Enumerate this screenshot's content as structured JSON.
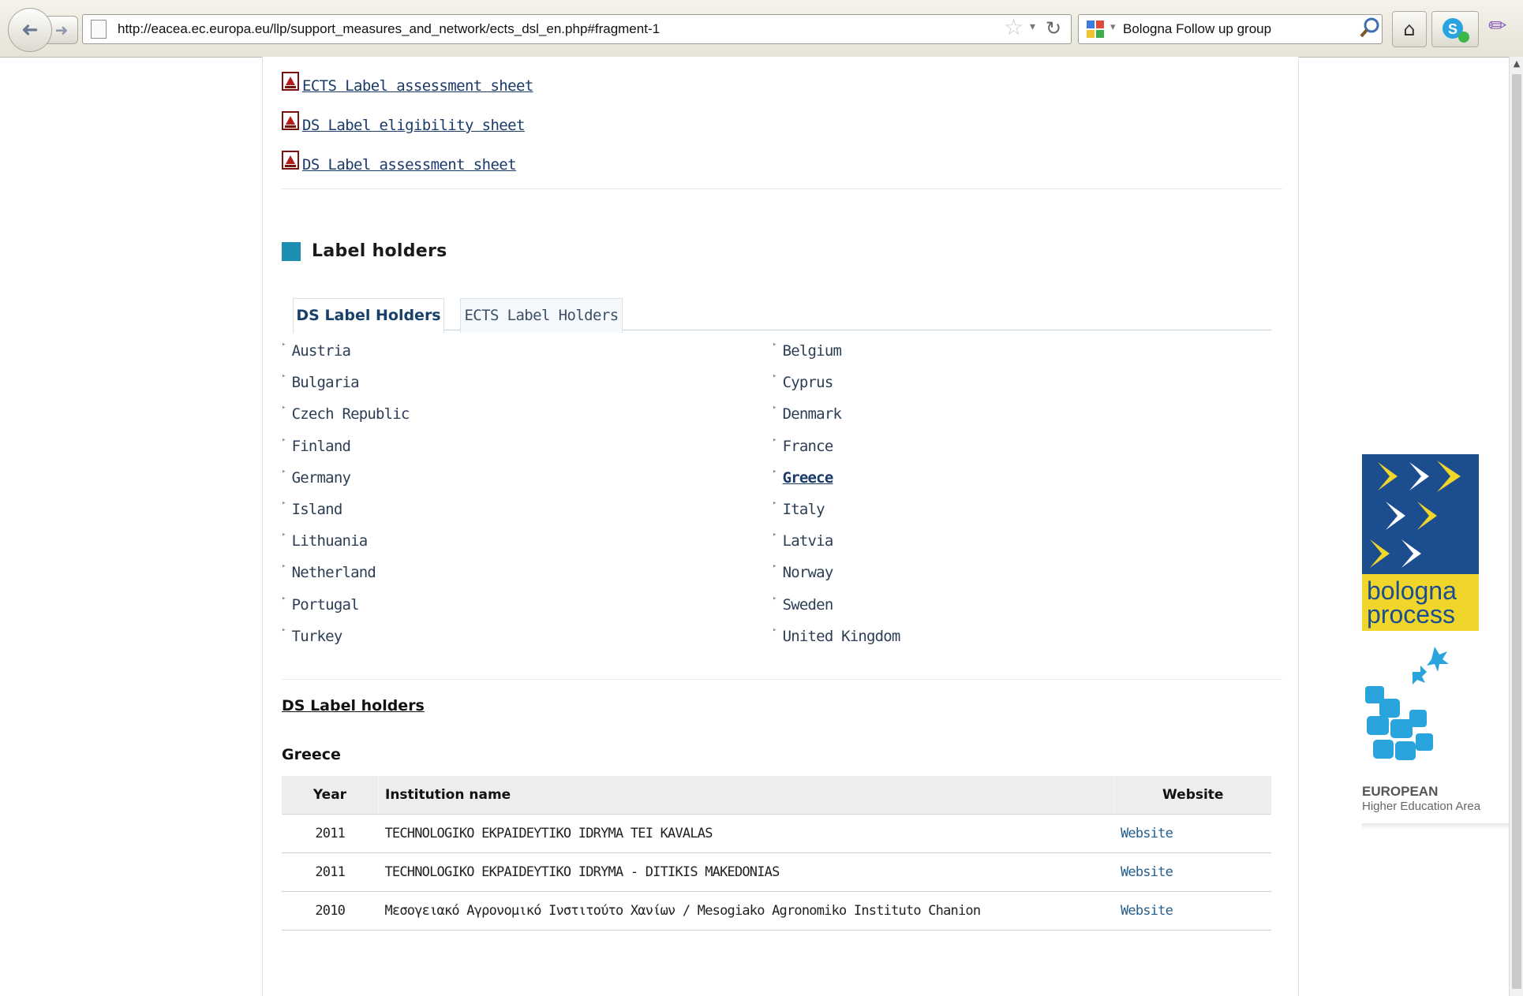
{
  "browser": {
    "url": "http://eacea.ec.europa.eu/llp/support_measures_and_network/ects_dsl_en.php#fragment-1",
    "search_text": "Bologna Follow up group"
  },
  "documents": [
    {
      "label": "ECTS Label assessment sheet"
    },
    {
      "label": "DS Label eligibility sheet"
    },
    {
      "label": "DS Label assessment sheet"
    }
  ],
  "section": {
    "title": "Label holders"
  },
  "tabs": [
    {
      "label": "DS Label Holders",
      "active": true
    },
    {
      "label": "ECTS Label Holders",
      "active": false
    }
  ],
  "countries": {
    "left": [
      "Austria",
      "Bulgaria",
      "Czech Republic",
      "Finland",
      "Germany",
      "Island",
      "Lithuania",
      "Netherland",
      "Portugal",
      "Turkey"
    ],
    "right": [
      "Belgium",
      "Cyprus",
      "Denmark",
      "France",
      "Greece",
      "Italy",
      "Latvia",
      "Norway",
      "Sweden",
      "United Kingdom"
    ],
    "selected": "Greece"
  },
  "holders": {
    "title": "DS Label holders",
    "country": "Greece",
    "columns": {
      "year": "Year",
      "institution": "Institution name",
      "website": "Website"
    },
    "rows": [
      {
        "year": "2011",
        "institution": "TECHNOLOGIKO EKPAIDEYTIKO IDRYMA TEI KAVALAS",
        "website": "Website"
      },
      {
        "year": "2011",
        "institution": "TECHNOLOGIKO EKPAIDEYTIKO IDRYMA - DITIKIS MAKEDONIAS",
        "website": "Website"
      },
      {
        "year": "2010",
        "institution": "Μεσογειακό Αγρονομικό Ινστιτούτο Χανίων / Mesogiako Agronomiko Instituto Chanion",
        "website": "Website"
      }
    ]
  },
  "logo": {
    "word1": "bologna",
    "word2": "process",
    "ehea_line1": "EUROPEAN",
    "ehea_line2": "Higher Education Area"
  },
  "colors": {
    "accent": "#1c8fb3",
    "link": "#1a3a6a",
    "logo_blue": "#1c4d8f",
    "logo_yellow": "#f0d62a"
  }
}
